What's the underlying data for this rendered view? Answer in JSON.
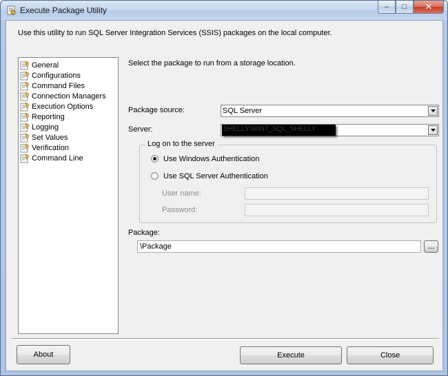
{
  "window": {
    "title": "Execute Package Utility",
    "minimize_glyph": "–",
    "maximize_glyph": "□",
    "close_glyph": "✕"
  },
  "description": "Use this utility to run SQL Server Integration Services (SSIS) packages on the local computer.",
  "nav": {
    "items": [
      {
        "label": "General",
        "icon": "page-settings-icon"
      },
      {
        "label": "Configurations",
        "icon": "page-settings-icon"
      },
      {
        "label": "Command Files",
        "icon": "page-settings-icon"
      },
      {
        "label": "Connection Managers",
        "icon": "page-settings-icon"
      },
      {
        "label": "Execution Options",
        "icon": "page-settings-icon"
      },
      {
        "label": "Reporting",
        "icon": "page-settings-icon"
      },
      {
        "label": "Logging",
        "icon": "page-settings-icon"
      },
      {
        "label": "Set Values",
        "icon": "page-settings-icon"
      },
      {
        "label": "Verification",
        "icon": "page-settings-icon"
      },
      {
        "label": "Command Line",
        "icon": "page-settings-icon"
      }
    ]
  },
  "content": {
    "instruction": "Select the package to run from a storage location.",
    "package_source": {
      "label": "Package source:",
      "value": "SQL Server"
    },
    "server": {
      "label": "Server:",
      "value_redacted": "SHELLY\\WIN7_SQL_SHELLY"
    },
    "logon": {
      "title": "Log on to the server",
      "windows_auth": "Use Windows Authentication",
      "sql_auth": "Use SQL Server Authentication",
      "selected": "windows",
      "username_label": "User name:",
      "password_label": "Password:",
      "username_value": "",
      "password_value": ""
    },
    "package": {
      "label": "Package:",
      "value": "\\Package",
      "browse_label": "..."
    }
  },
  "buttons": {
    "about": "About",
    "execute": "Execute",
    "close": "Close"
  },
  "colors": {
    "titlebar": "#c2d5ec",
    "client_bg": "#f0f0f0",
    "close_button": "#c43b26"
  }
}
